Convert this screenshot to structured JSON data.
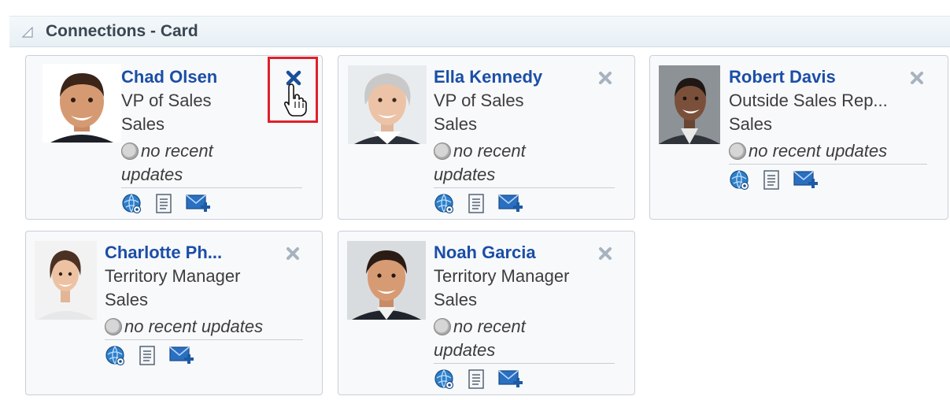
{
  "panel": {
    "title": "Connections - Card"
  },
  "status_text_a": "no recent",
  "status_text_b": "updates",
  "status_text_full": "no recent updates",
  "cards": [
    {
      "name": "Chad Olsen",
      "title": "VP of Sales",
      "department": "Sales",
      "close_active": true
    },
    {
      "name": "Ella Kennedy",
      "title": "VP of Sales",
      "department": "Sales",
      "close_active": false
    },
    {
      "name": "Robert Davis",
      "title": "Outside Sales Rep...",
      "department": "Sales",
      "close_active": false
    },
    {
      "name": "Charlotte Ph...",
      "title": "Territory Manager",
      "department": "Sales",
      "close_active": false
    },
    {
      "name": "Noah Garcia",
      "title": "Territory Manager",
      "department": "Sales",
      "close_active": false
    }
  ],
  "colors": {
    "name_link": "#1b4ea6",
    "close_active": "#1a4f9a",
    "close_inactive": "#a7b3bf",
    "highlight": "#e0202a"
  },
  "icons": [
    "collapse-triangle-icon",
    "connect-globe-icon",
    "profile-document-icon",
    "send-message-icon",
    "close-icon",
    "hand-pointer-icon"
  ]
}
